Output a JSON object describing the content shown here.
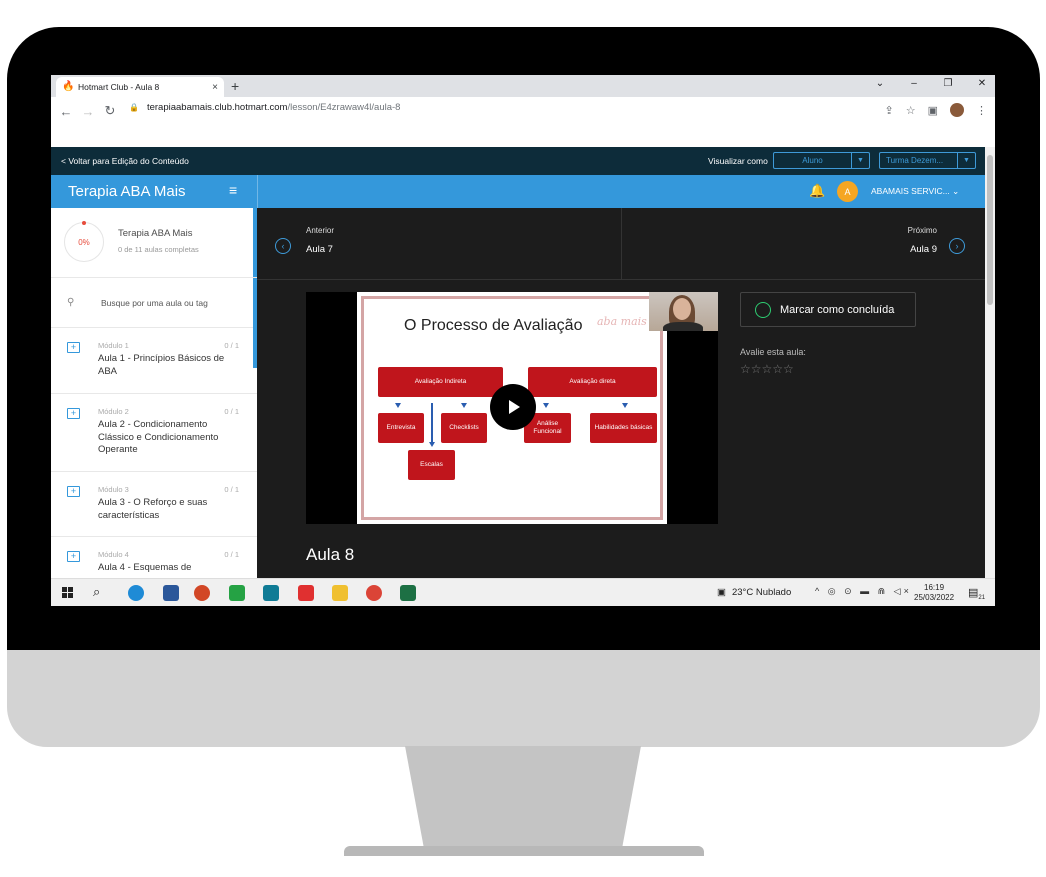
{
  "browser": {
    "tab_title": "Hotmart Club - Aula 8",
    "tab_close": "×",
    "new_tab": "+",
    "window_buttons": [
      "⌄",
      "–",
      "❐",
      "✕"
    ],
    "url_host": "terapiaabamais.club.hotmart.com",
    "url_path": "/lesson/E4zrawaw4l/aula-8"
  },
  "admin_bar": {
    "back_link": "< Voltar para Edição do Conteúdo",
    "view_as_label": "Visualizar como",
    "role_select": "Aluno",
    "class_select": "Turma Dezem..."
  },
  "header": {
    "brand": "Terapia ABA Mais",
    "avatar_letter": "A",
    "username": "ABAMAIS SERVIC... ⌄"
  },
  "sidebar": {
    "progress_pct": "0%",
    "course_name": "Terapia ABA Mais",
    "course_progress": "0 de 11 aulas completas",
    "search_placeholder": "Busque por uma aula ou tag",
    "modules": [
      {
        "label": "Módulo 1",
        "count": "0 / 1",
        "title": "Aula 1 - Princípios Básicos de ABA"
      },
      {
        "label": "Módulo 2",
        "count": "0 / 1",
        "title": "Aula 2 - Condicionamento Clássico e Condicionamento Operante"
      },
      {
        "label": "Módulo 3",
        "count": "0 / 1",
        "title": "Aula 3 - O Reforço e suas características"
      },
      {
        "label": "Módulo 4",
        "count": "0 / 1",
        "title": "Aula 4 - Esquemas de"
      }
    ]
  },
  "lesson_nav": {
    "prev_label": "Anterior",
    "prev_lesson": "Aula 7",
    "next_label": "Próximo",
    "next_lesson": "Aula 9"
  },
  "video": {
    "slide_title": "O Processo de Avaliação",
    "watermark": "aba mais",
    "boxes": {
      "indireta": "Avaliação Indireta",
      "direta": "Avaliação direta",
      "entrevista": "Entrevista",
      "checklists": "Checklists",
      "analise": "Análise Funcional",
      "habilidades": "Habilidades básicas",
      "escalas": "Escalas"
    }
  },
  "lesson": {
    "title": "Aula 8",
    "mark_done": "Marcar como concluída",
    "rate_label": "Avalie esta aula:",
    "stars": "☆☆☆☆☆"
  },
  "taskbar": {
    "weather": "23°C  Nublado",
    "time": "16:19",
    "date": "25/03/2022",
    "notification_count": "21"
  }
}
